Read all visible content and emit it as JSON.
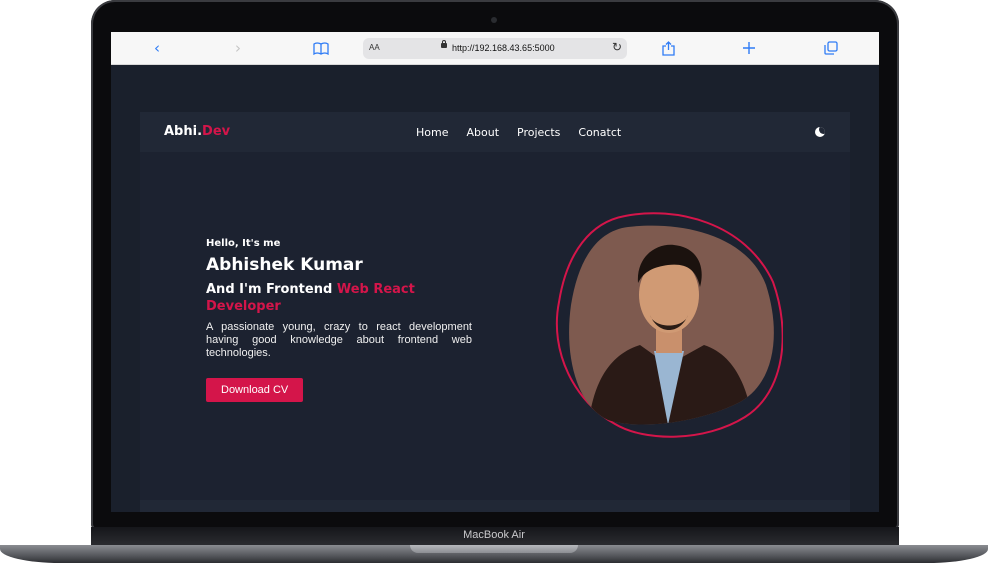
{
  "browser": {
    "url": "http://192.168.43.65:5000",
    "text_size_label": "AA",
    "icons": [
      "back-icon",
      "forward-icon",
      "bookmarks-icon",
      "reload-icon",
      "share-icon",
      "new-tab-icon",
      "tabs-icon"
    ]
  },
  "nav": {
    "logo_main": "Abhi.",
    "logo_accent": "Dev",
    "links": [
      "Home",
      "About",
      "Projects",
      "Conatct"
    ],
    "theme_icon": "moon-icon"
  },
  "hero": {
    "greeting": "Hello, It's me",
    "name": "Abhishek Kumar",
    "role_prefix": "And I'm Frontend ",
    "role_accent": "Web React Developer",
    "description": "A passionate young, crazy to react development having good knowledge about frontend web technologies.",
    "cta": "Download CV"
  },
  "device": {
    "label": "MacBook Air"
  },
  "colors": {
    "accent": "#d4154a",
    "background": "#1c2230",
    "nav": "#212836"
  }
}
